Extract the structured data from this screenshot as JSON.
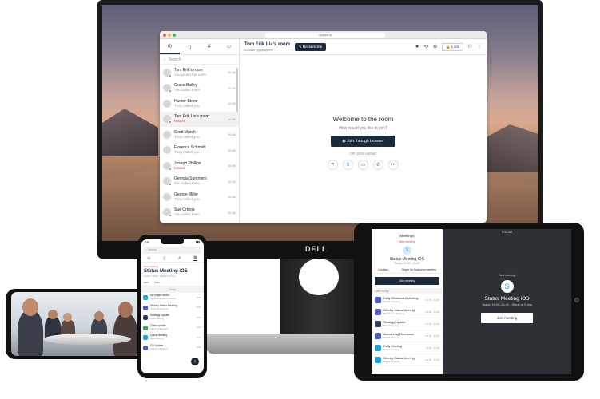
{
  "desktop": {
    "browser": {
      "url": "vyopta.io",
      "sidebar_search_placeholder": "Search",
      "contacts": [
        {
          "name": "Tom Erik's room",
          "sub": "You joined the room",
          "time": "10:46",
          "missed": false,
          "online": true
        },
        {
          "name": "Grace Bailey",
          "sub": "You called them",
          "time": "10:46",
          "missed": false,
          "online": true
        },
        {
          "name": "Hunter Stone",
          "sub": "They called you",
          "time": "10:46",
          "missed": false,
          "online": false
        },
        {
          "name": "Tom Erik Lia's room",
          "sub": "Missed",
          "time": "10:46",
          "missed": true,
          "online": true
        },
        {
          "name": "Scott Marsh",
          "sub": "They called you",
          "time": "10:46",
          "missed": false,
          "online": false
        },
        {
          "name": "Florence Schmidt",
          "sub": "They called you",
          "time": "10:46",
          "missed": false,
          "online": false
        },
        {
          "name": "Joseph Phillips",
          "sub": "Missed",
          "time": "10:46",
          "missed": true,
          "online": true
        },
        {
          "name": "Georgia Summers",
          "sub": "You called them",
          "time": "10:46",
          "missed": false,
          "online": true
        },
        {
          "name": "George Miller",
          "sub": "They called you",
          "time": "10:46",
          "missed": false,
          "online": false
        },
        {
          "name": "Sue Ortega",
          "sub": "You called them",
          "time": "10:46",
          "missed": false,
          "online": true
        }
      ],
      "room_title": "Tom Erik Lia's room",
      "room_sub": "1234567@pexip.me",
      "reclaim_label": "Reclaim link",
      "lock_label": "Lock",
      "welcome_title": "Welcome to the room",
      "welcome_sub": "How would you like to join?",
      "join_browser_label": "Join through browser",
      "or_join_label": "OR JOIN USING",
      "brand_text": "DELL"
    }
  },
  "tablet": {
    "status_time": "9:41 AM",
    "header": "Meetings",
    "next_label": "Next meeting",
    "meeting_title": "Status Meeting iOS",
    "meeting_time": "Today, 10:00 - 10:45",
    "tabs": [
      "Location",
      "Skype for Business meeting"
    ],
    "join_label": "Join meeting",
    "section": "Later today",
    "items": [
      {
        "title": "Daily Whiteboard Meeting",
        "sub": "Neville Meeting",
        "time": "10:45 - 11:45",
        "color": "#4a5ec7"
      },
      {
        "title": "Weekly Status Meeting",
        "sub": "Boardroom Meeting",
        "time": "10:45 - 11:45",
        "color": "#4a5ec7"
      },
      {
        "title": "Strategy Update",
        "sub": "Board Meeting",
        "time": "10:45 - 11:45",
        "color": "#2c3e66"
      },
      {
        "title": "Accounting Discussion",
        "sub": "Board Meeting",
        "time": "10:45 - 11:45",
        "color": "#4a5ec7"
      },
      {
        "title": "Daily Meeting",
        "sub": "Board Meeting",
        "time": "10:45 - 11:45",
        "color": "#1ea3d8"
      },
      {
        "title": "Weekly Status Meeting",
        "sub": "Board Meeting",
        "time": "10:45 - 11:45",
        "color": "#1ea3d8"
      }
    ],
    "right_next": "Next meeting",
    "right_title": "Status Meeting iOS",
    "right_time": "Today, 10:00-10:30 - Starts in 5 min",
    "right_join": "Join meeting"
  },
  "phone": {
    "time": "9:41",
    "search_placeholder": "Search",
    "next_label": "Next meeting",
    "title": "Status Meeting iOS",
    "time_range": "10:00 - 10:30 - Starts in 5 min",
    "actions": [
      "EDIT",
      "JOIN"
    ],
    "section": "Today",
    "items": [
      {
        "title": "My pages demo",
        "sub": "Skype for Business meeting",
        "time": "10:00",
        "color": "#1ea3d8"
      },
      {
        "title": "Weekly Status Meeting",
        "sub": "Skype for Business",
        "time": "10:00",
        "color": "#4a5ec7"
      },
      {
        "title": "Strategy Update",
        "sub": "Board Meeting",
        "time": "10:00",
        "color": "#2c3e66"
      },
      {
        "title": "Client update",
        "sub": "Skype for Business",
        "time": "10:00",
        "color": "#3aa55c"
      },
      {
        "title": "Quick Meeting",
        "sub": "Board Meeting",
        "time": "10:00",
        "color": "#1ea3d8"
      },
      {
        "title": "CU Update",
        "sub": "Skype for Business",
        "time": "10:00",
        "color": "#4a5ec7"
      }
    ]
  }
}
